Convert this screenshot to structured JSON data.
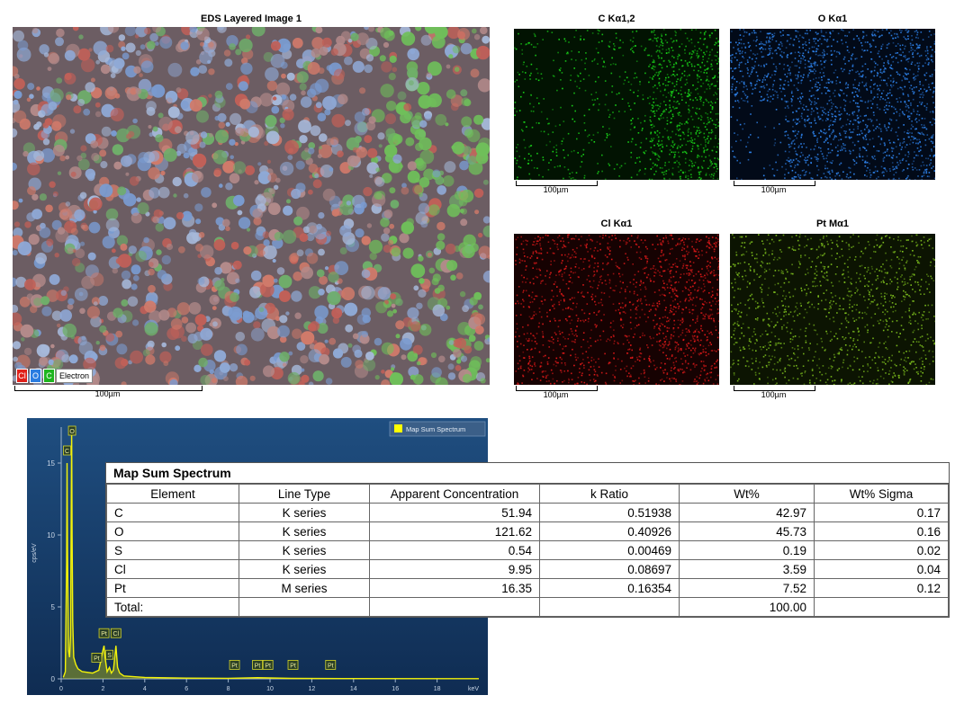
{
  "layered": {
    "title": "EDS Layered Image 1",
    "legend": [
      {
        "label": "Cl",
        "color": "#e0201a"
      },
      {
        "label": "O",
        "color": "#2a7de1"
      },
      {
        "label": "C",
        "color": "#1fb51f"
      }
    ],
    "electron_label": "Electron",
    "scale": "100µm"
  },
  "maps": [
    {
      "title": "C Kα1,2",
      "color": "#19d419",
      "bg": "#021302",
      "scale": "100µm"
    },
    {
      "title": "O Kα1",
      "color": "#2f86f2",
      "bg": "#020a18",
      "scale": "100µm"
    },
    {
      "title": "Cl Kα1",
      "color": "#e31a1a",
      "bg": "#160202",
      "scale": "100µm"
    },
    {
      "title": "Pt Mα1",
      "color": "#7fc21e",
      "bg": "#0c1402",
      "scale": "100µm"
    }
  ],
  "chart_data": {
    "type": "line",
    "title": "",
    "legend": "Map Sum Spectrum",
    "xlabel": "keV",
    "ylabel": "cps/eV",
    "xlim": [
      0,
      20
    ],
    "ylim": [
      0,
      17.5
    ],
    "xticks": [
      0,
      2,
      4,
      6,
      8,
      10,
      12,
      14,
      16,
      18
    ],
    "yticks": [
      0,
      5,
      10,
      15
    ],
    "series": [
      {
        "name": "Map Sum Spectrum",
        "x": [
          0.1,
          0.2,
          0.26,
          0.28,
          0.3,
          0.35,
          0.4,
          0.45,
          0.5,
          0.52,
          0.55,
          0.6,
          0.7,
          0.8,
          1.0,
          1.5,
          1.8,
          2.0,
          2.05,
          2.1,
          2.2,
          2.31,
          2.4,
          2.5,
          2.62,
          2.7,
          2.8,
          3.0,
          4.0,
          6.0,
          8.0,
          9.4,
          11.0,
          14.0,
          20.0
        ],
        "y": [
          0.1,
          0.5,
          8.0,
          15.0,
          9.0,
          2.0,
          1.5,
          3.0,
          17.5,
          10.0,
          4.0,
          1.5,
          1.0,
          0.7,
          0.5,
          0.4,
          0.6,
          2.0,
          2.3,
          1.5,
          0.5,
          0.8,
          0.4,
          0.6,
          2.3,
          0.8,
          0.4,
          0.2,
          0.1,
          0.05,
          0.04,
          0.08,
          0.03,
          0.02,
          0.01
        ]
      }
    ],
    "peak_labels": [
      {
        "label": "O",
        "x": 0.52,
        "y": 17.5
      },
      {
        "label": "C",
        "x": 0.28,
        "y": 15.0
      },
      {
        "label": "Pt",
        "x": 2.05,
        "y": 2.3
      },
      {
        "label": "Cl",
        "x": 2.62,
        "y": 2.3
      },
      {
        "label": "Pt",
        "x": 1.7,
        "y": 0.6
      },
      {
        "label": "S",
        "x": 2.31,
        "y": 0.8
      },
      {
        "label": "Pt",
        "x": 8.3,
        "y": 0.1
      },
      {
        "label": "Pt",
        "x": 9.4,
        "y": 0.1
      },
      {
        "label": "Pt",
        "x": 9.9,
        "y": 0.1
      },
      {
        "label": "Pt",
        "x": 11.1,
        "y": 0.1
      },
      {
        "label": "Pt",
        "x": 12.9,
        "y": 0.1
      }
    ]
  },
  "table": {
    "caption": "Map Sum Spectrum",
    "headers": [
      "Element",
      "Line Type",
      "Apparent Concentration",
      "k Ratio",
      "Wt%",
      "Wt% Sigma"
    ],
    "rows": [
      [
        "C",
        "K series",
        "51.94",
        "0.51938",
        "42.97",
        "0.17"
      ],
      [
        "O",
        "K series",
        "121.62",
        "0.40926",
        "45.73",
        "0.16"
      ],
      [
        "S",
        "K series",
        "0.54",
        "0.00469",
        "0.19",
        "0.02"
      ],
      [
        "Cl",
        "K series",
        "9.95",
        "0.08697",
        "3.59",
        "0.04"
      ],
      [
        "Pt",
        "M series",
        "16.35",
        "0.16354",
        "7.52",
        "0.12"
      ]
    ],
    "total_label": "Total:",
    "total_wt": "100.00"
  }
}
